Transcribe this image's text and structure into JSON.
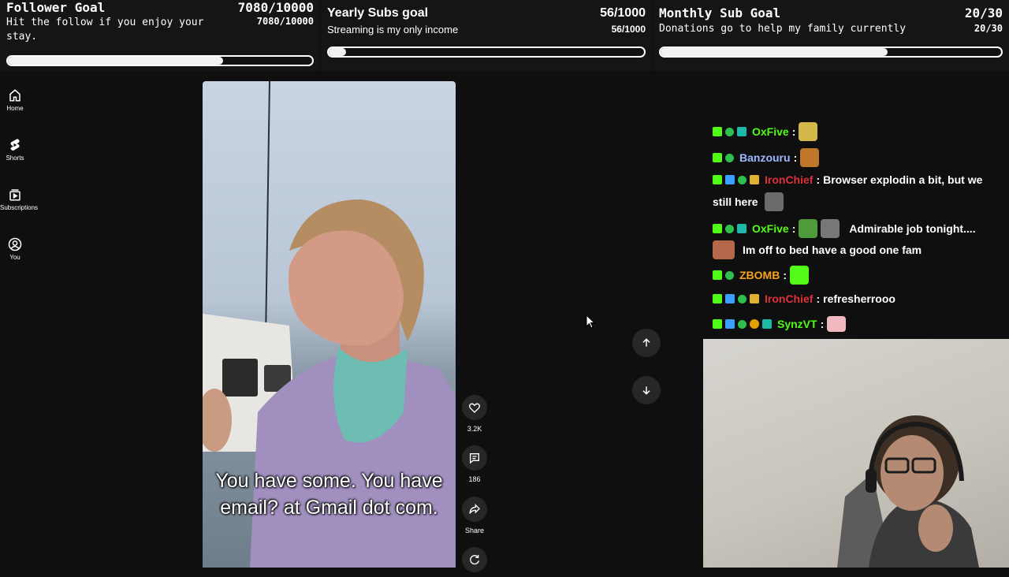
{
  "goals": {
    "follower": {
      "title": "Follower Goal",
      "count_big": "7080/10000",
      "description": "Hit the follow if you enjoy your stay.",
      "count_small": "7080/10000",
      "progress": 0.708
    },
    "yearly": {
      "title": "Yearly Subs goal",
      "count_big": "56/1000",
      "description": "Streaming is my only income",
      "count_small": "56/1000",
      "progress": 0.056
    },
    "monthly": {
      "title": "Monthly Sub Goal",
      "count_big": "20/30",
      "description": "Donations go to help my family currently",
      "count_small": "20/30",
      "progress": 0.667
    }
  },
  "sidebar": {
    "items": [
      {
        "label": "Home",
        "icon": "home-icon"
      },
      {
        "label": "Shorts",
        "icon": "shorts-icon"
      },
      {
        "label": "Subscriptions",
        "icon": "subscriptions-icon"
      },
      {
        "label": "You",
        "icon": "account-icon"
      }
    ]
  },
  "video": {
    "caption_line1": "You have some. You have",
    "caption_line2": "email? at Gmail dot com."
  },
  "actions": {
    "like_count": "3.2K",
    "comment_count": "186",
    "share_label": "Share"
  },
  "chat": {
    "messages": [
      {
        "user": "OxFive",
        "color": "#53fc18",
        "text": ""
      },
      {
        "user": "Banzouru",
        "color": "#9fb6ff",
        "text": ""
      },
      {
        "user": "IronChief",
        "color": "#e0303a",
        "text": "Browser explodin a bit, but we",
        "text2": "still here"
      },
      {
        "user": "OxFive",
        "color": "#53fc18",
        "text": "Admirable job tonight....",
        "text2": "Im off to bed have a good one fam"
      },
      {
        "user": "ZBOMB",
        "color": "#f7a21b",
        "text": ""
      },
      {
        "user": "IronChief",
        "color": "#e0303a",
        "text": "refresherrooo"
      },
      {
        "user": "SynzVT",
        "color": "#53fc18",
        "text": ""
      }
    ]
  }
}
